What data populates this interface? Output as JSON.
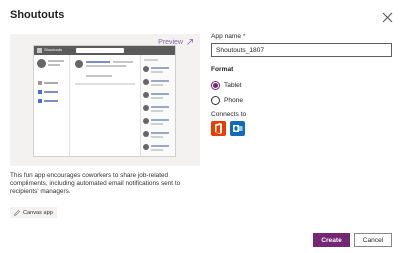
{
  "dialog": {
    "title": "Shoutouts"
  },
  "preview": {
    "link_label": "Preview",
    "description": "This fun app encourages coworkers to share job-related compliments, including automated email notifications sent to recipients' managers.",
    "tag": "Canvas app"
  },
  "form": {
    "app_name_label": "App name",
    "required_marker": "*",
    "app_name_value": "Shoutouts_1807",
    "format_label": "Format",
    "options": [
      {
        "label": "Tablet",
        "selected": true
      },
      {
        "label": "Phone",
        "selected": false
      }
    ],
    "connects_label": "Connects to",
    "connectors": [
      {
        "name": "office-365-icon",
        "color": "#eb3c00"
      },
      {
        "name": "outlook-icon",
        "color": "#0f6cbd"
      }
    ]
  },
  "buttons": {
    "create": "Create",
    "cancel": "Cancel"
  },
  "colors": {
    "accent": "#742774",
    "preview_link": "#8a63a8",
    "preview_bg": "#f3f2f1"
  }
}
